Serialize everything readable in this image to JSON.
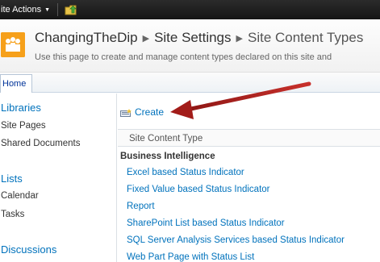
{
  "ribbon": {
    "site_actions_label": "ite Actions"
  },
  "header": {
    "breadcrumb": [
      "ChangingTheDip",
      "Site Settings",
      "Site Content Types"
    ],
    "description": "Use this page to create and manage content types declared on this site and"
  },
  "topnav": {
    "home_label": "Home"
  },
  "quicklaunch": {
    "libraries_heading": "Libraries",
    "libraries": [
      "Site Pages",
      "Shared Documents"
    ],
    "lists_heading": "Lists",
    "lists": [
      "Calendar",
      "Tasks"
    ],
    "discussions_heading": "Discussions"
  },
  "main": {
    "create_label": "Create",
    "column_header": "Site Content Type",
    "group_title": "Business Intelligence",
    "items": [
      "Excel based Status Indicator",
      "Fixed Value based Status Indicator",
      "Report",
      "SharePoint List based Status Indicator",
      "SQL Server Analysis Services based Status Indicator",
      "Web Part Page with Status List"
    ]
  },
  "colors": {
    "link": "#0072bc",
    "annotation_arrow": "#b3201e",
    "logo": "#f6a01a"
  }
}
